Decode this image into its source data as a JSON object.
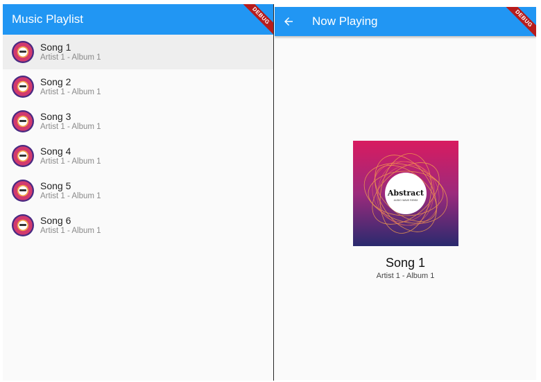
{
  "colors": {
    "appbar": "#2196f3",
    "ribbon": "#b71c1c",
    "selected_row": "#eeeeee"
  },
  "playlist": {
    "title": "Music Playlist",
    "debug_label": "DEBUG",
    "songs": [
      {
        "title": "Song 1",
        "subtitle": "Artist 1 - Album 1",
        "selected": true
      },
      {
        "title": "Song 2",
        "subtitle": "Artist 1 - Album 1"
      },
      {
        "title": "Song 3",
        "subtitle": "Artist 1 - Album 1"
      },
      {
        "title": "Song 4",
        "subtitle": "Artist 1 - Album 1"
      },
      {
        "title": "Song 5",
        "subtitle": "Artist 1 - Album 1"
      },
      {
        "title": "Song 6",
        "subtitle": "Artist 1 - Album 1"
      }
    ]
  },
  "now_playing": {
    "title": "Now Playing",
    "back_icon": "arrow-back-icon",
    "debug_label": "DEBUG",
    "album_art_text": "Abstract",
    "album_art_subtext": "AUDIO WAVE REMIX",
    "song_title": "Song 1",
    "song_subtitle": "Artist 1 - Album 1"
  }
}
